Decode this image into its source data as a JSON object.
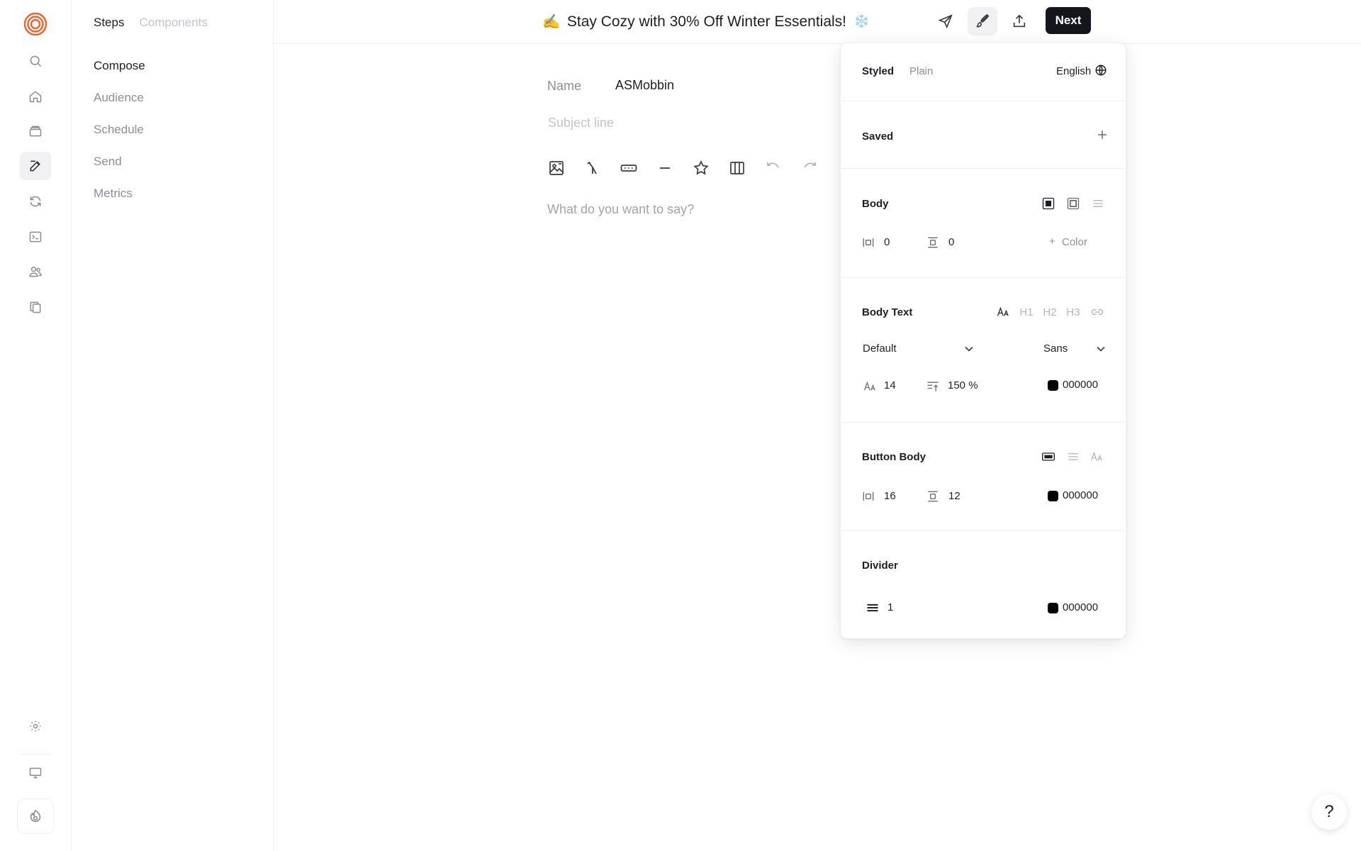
{
  "rail": {
    "items": [
      {
        "name": "search-icon"
      },
      {
        "name": "home-icon"
      },
      {
        "name": "inbox-icon"
      },
      {
        "name": "compose-icon",
        "active": true
      },
      {
        "name": "sync-icon"
      },
      {
        "name": "terminal-icon"
      },
      {
        "name": "users-icon"
      },
      {
        "name": "copy-icon"
      }
    ],
    "bottom": [
      {
        "name": "settings-icon"
      },
      {
        "name": "monitor-icon"
      },
      {
        "name": "account-icon"
      }
    ]
  },
  "steps": {
    "tabs": {
      "steps": "Steps",
      "components": "Components"
    },
    "items": [
      {
        "label": "Compose",
        "active": true
      },
      {
        "label": "Audience"
      },
      {
        "label": "Schedule"
      },
      {
        "label": "Send"
      },
      {
        "label": "Metrics"
      }
    ]
  },
  "header": {
    "emoji": "✍️",
    "title": "Stay Cozy with 30% Off Winter Essentials!",
    "title_suffix": "❄️",
    "next_label": "Next"
  },
  "editor": {
    "name_label": "Name",
    "name_value": "ASMobbin",
    "subject_placeholder": "Subject line",
    "body_placeholder": "What do you want to say?"
  },
  "panel": {
    "mode_styled": "Styled",
    "mode_plain": "Plain",
    "language": "English",
    "saved_label": "Saved",
    "body": {
      "label": "Body",
      "padding_x": "0",
      "padding_y": "0",
      "color_label": "Color"
    },
    "body_text": {
      "label": "Body Text",
      "style_select": "Default",
      "font_select": "Sans",
      "size": "14",
      "line_height": "150 %",
      "color": "000000",
      "heading_buttons": [
        "H1",
        "H2",
        "H3"
      ]
    },
    "button_body": {
      "label": "Button Body",
      "padding_x": "16",
      "padding_y": "12",
      "color": "000000"
    },
    "divider": {
      "label": "Divider",
      "thickness": "1",
      "color": "000000"
    }
  },
  "help_label": "?"
}
